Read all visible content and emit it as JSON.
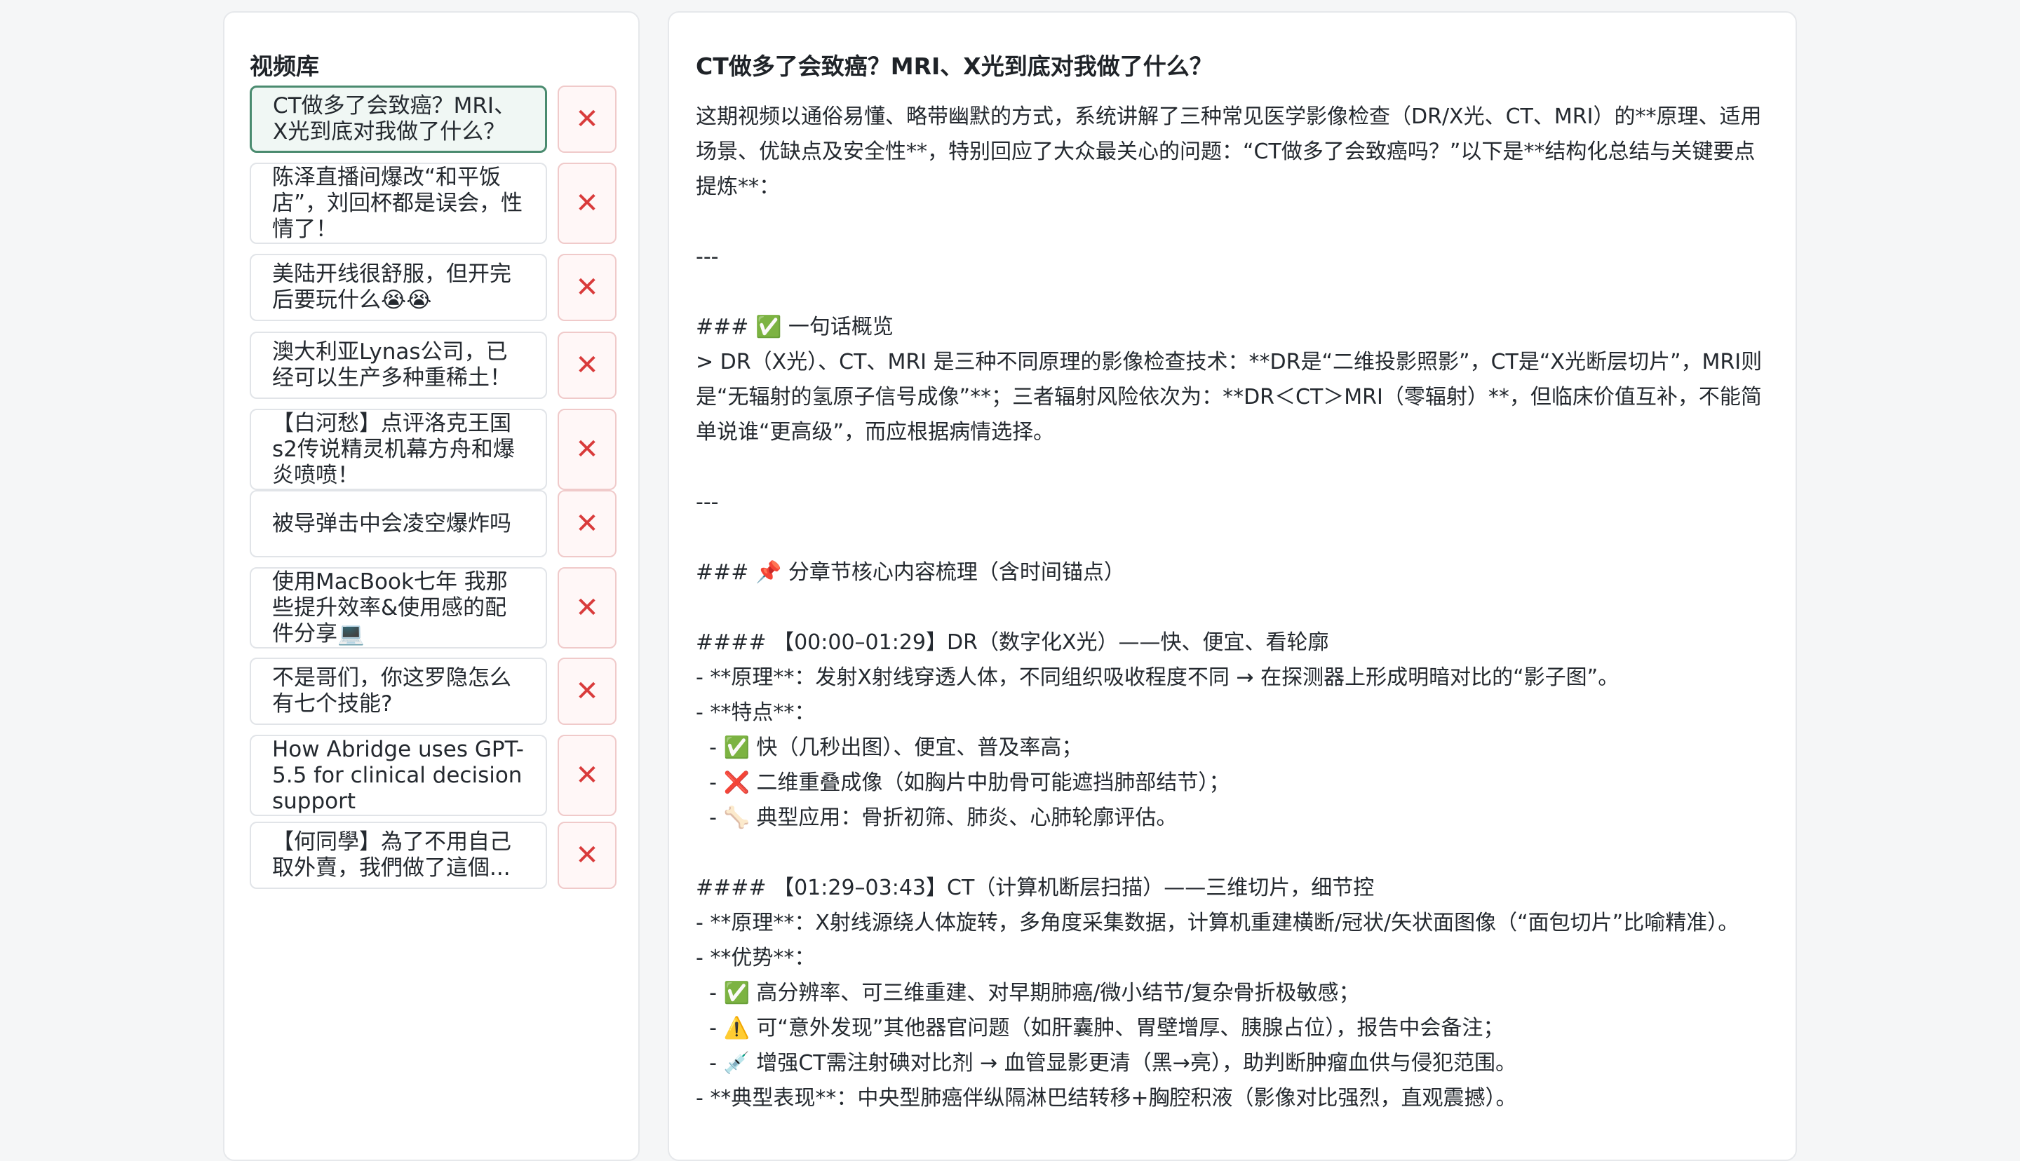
{
  "sidebar": {
    "title": "视频库",
    "items": [
      {
        "title": "CT做多了会致癌？MRI、X光到底对我做了什么？",
        "active": true
      },
      {
        "title": "陈泽直播间爆改“和平饭店”，刘回杯都是误会，性情了！",
        "active": false
      },
      {
        "title": "美陆开线很舒服，但开完后要玩什么😭😭",
        "active": false
      },
      {
        "title": "澳大利亚Lynas公司，已经可以生产多种重稀土！",
        "active": false
      },
      {
        "title": "【白河愁】点评洛克王国s2传说精灵机幕方舟和爆炎喷喷！",
        "active": false
      },
      {
        "title": "被导弹击中会凌空爆炸吗",
        "active": false
      },
      {
        "title": "使用MacBook七年 我那些提升效率&使用感的配件分享💻",
        "active": false
      },
      {
        "title": "不是哥们，你这罗隐怎么有七个技能?",
        "active": false
      },
      {
        "title": "How Abridge uses GPT-5.5 for clinical decision support",
        "active": false
      },
      {
        "title": "【何同學】為了不用自己取外賣，我們做了這個...",
        "active": false
      }
    ],
    "delete_label": "✕"
  },
  "main": {
    "title": "CT做多了会致癌？MRI、X光到底对我做了什么？",
    "body": "这期视频以通俗易懂、略带幽默的方式，系统讲解了三种常见医学影像检查（DR/X光、CT、MRI）的**原理、适用场景、优缺点及安全性**，特别回应了大众最关心的问题：“CT做多了会致癌吗？”以下是**结构化总结与关键要点提炼**：\n\n---\n\n### ✅ 一句话概览\n> DR（X光）、CT、MRI 是三种不同原理的影像检查技术：**DR是“二维投影照影”，CT是“X光断层切片”，MRI则是“无辐射的氢原子信号成像”**；三者辐射风险依次为：**DR＜CT＞MRI（零辐射）**，但临床价值互补，不能简单说谁“更高级”，而应根据病情选择。\n\n---\n\n### 📌 分章节核心内容梳理（含时间锚点）\n\n#### 【00:00–01:29】DR（数字化X光）——快、便宜、看轮廓\n- **原理**：发射X射线穿透人体，不同组织吸收程度不同 → 在探测器上形成明暗对比的“影子图”。\n- **特点**：\n  - ✅ 快（几秒出图）、便宜、普及率高；\n  - ❌ 二维重叠成像（如胸片中肋骨可能遮挡肺部结节）；\n  - 🦴 典型应用：骨折初筛、肺炎、心肺轮廓评估。\n\n#### 【01:29–03:43】CT（计算机断层扫描）——三维切片，细节控\n- **原理**：X射线源绕人体旋转，多角度采集数据，计算机重建横断/冠状/矢状面图像（“面包切片”比喻精准）。\n- **优势**：\n  - ✅ 高分辨率、可三维重建、对早期肺癌/微小结节/复杂骨折极敏感；\n  - ⚠️ 可“意外发现”其他器官问题（如肝囊肿、胃壁增厚、胰腺占位），报告中会备注；\n  - 💉 增强CT需注射碘对比剂 → 血管显影更清（黑→亮），助判断肿瘤血供与侵犯范围。\n- **典型表现**：中央型肺癌伴纵隔淋巴结转移+胸腔积液（影像对比强烈，直观震撼）。"
  }
}
